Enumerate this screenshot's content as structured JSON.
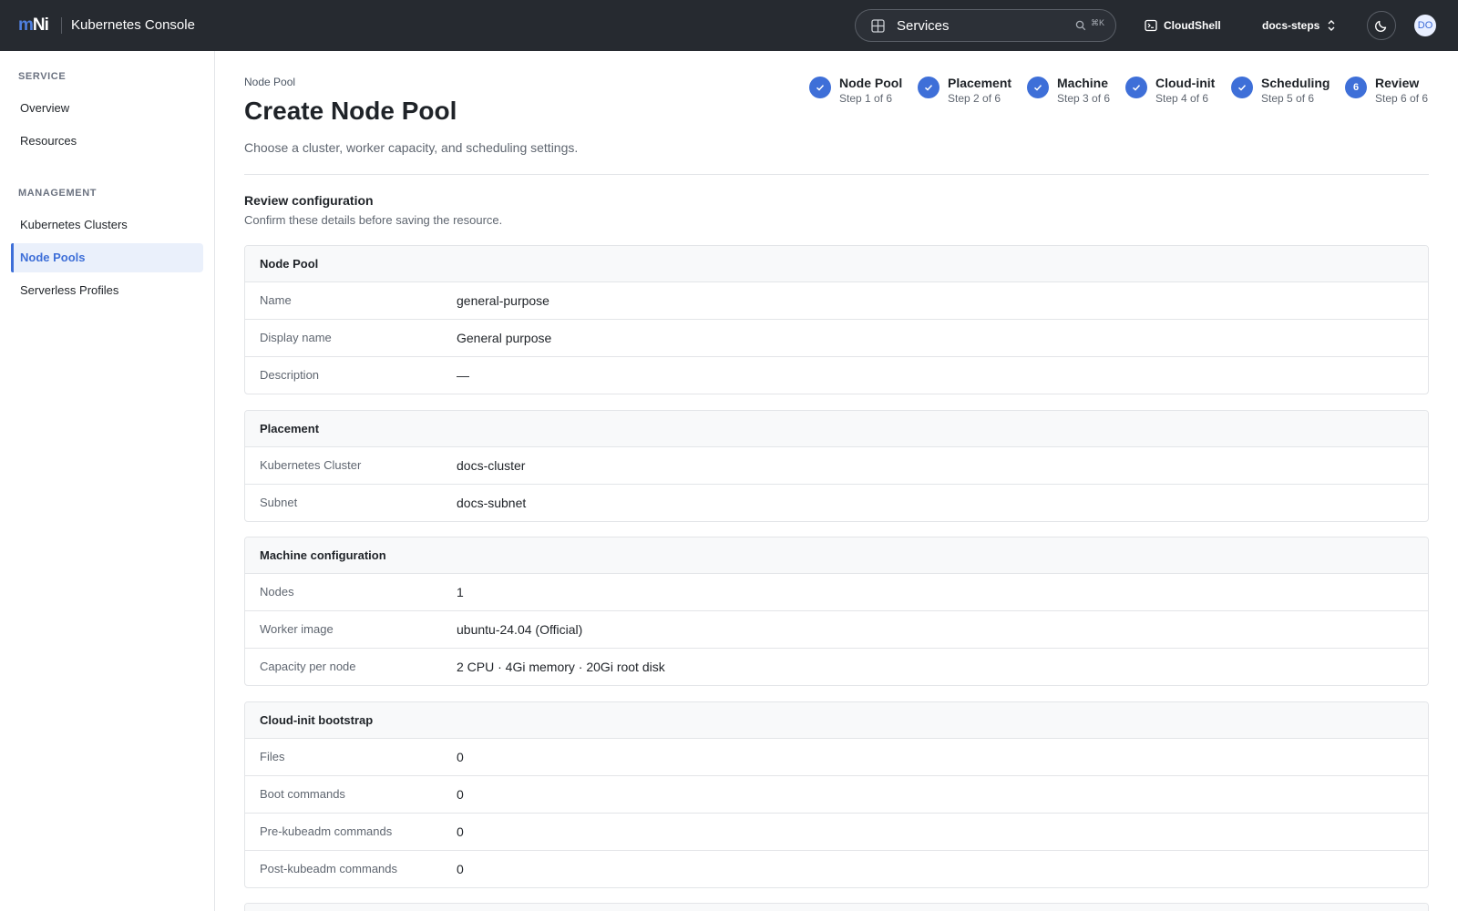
{
  "header": {
    "logo_m": "m",
    "logo_n": "Ni",
    "app_title": "Kubernetes Console",
    "search_text": "Services",
    "search_shortcut": "⌘K",
    "cloudshell_label": "CloudShell",
    "project_label": "docs-steps",
    "avatar_initials": "DO",
    "icons": [
      "grid-icon",
      "search-icon",
      "terminal-icon",
      "chevrons-updown-icon",
      "moon-icon"
    ]
  },
  "sidebar": {
    "service_heading": "SERVICE",
    "service_items": [
      {
        "label": "Overview"
      },
      {
        "label": "Resources"
      }
    ],
    "management_heading": "MANAGEMENT",
    "management_items": [
      {
        "label": "Kubernetes Clusters"
      },
      {
        "label": "Node Pools",
        "active": true
      },
      {
        "label": "Serverless Profiles"
      }
    ]
  },
  "page": {
    "breadcrumb": "Node Pool",
    "title": "Create Node Pool",
    "subtitle": "Choose a cluster, worker capacity, and scheduling settings."
  },
  "stepper": [
    {
      "label": "Node Pool",
      "sub": "Step 1 of 6",
      "state": "complete"
    },
    {
      "label": "Placement",
      "sub": "Step 2 of 6",
      "state": "complete"
    },
    {
      "label": "Machine",
      "sub": "Step 3 of 6",
      "state": "complete"
    },
    {
      "label": "Cloud-init",
      "sub": "Step 4 of 6",
      "state": "complete"
    },
    {
      "label": "Scheduling",
      "sub": "Step 5 of 6",
      "state": "complete"
    },
    {
      "label": "Review",
      "sub": "Step 6 of 6",
      "state": "current",
      "number": "6"
    }
  ],
  "review": {
    "title": "Review configuration",
    "subtitle": "Confirm these details before saving the resource.",
    "sections": [
      {
        "title": "Node Pool",
        "rows": [
          {
            "label": "Name",
            "value": "general-purpose"
          },
          {
            "label": "Display name",
            "value": "General purpose"
          },
          {
            "label": "Description",
            "value": "—"
          }
        ]
      },
      {
        "title": "Placement",
        "rows": [
          {
            "label": "Kubernetes Cluster",
            "value": "docs-cluster"
          },
          {
            "label": "Subnet",
            "value": "docs-subnet"
          }
        ]
      },
      {
        "title": "Machine configuration",
        "rows": [
          {
            "label": "Nodes",
            "value": "1"
          },
          {
            "label": "Worker image",
            "value": "ubuntu-24.04 (Official)"
          },
          {
            "label": "Capacity per node",
            "value": "2 CPU · 4Gi memory · 20Gi root disk"
          }
        ]
      },
      {
        "title": "Cloud-init bootstrap",
        "rows": [
          {
            "label": "Files",
            "value": "0"
          },
          {
            "label": "Boot commands",
            "value": "0"
          },
          {
            "label": "Pre-kubeadm commands",
            "value": "0"
          },
          {
            "label": "Post-kubeadm commands",
            "value": "0"
          }
        ]
      }
    ]
  },
  "colors": {
    "topbar": "#262a30",
    "accent": "#3e6fd8",
    "active_bg": "#eaf0fb"
  }
}
